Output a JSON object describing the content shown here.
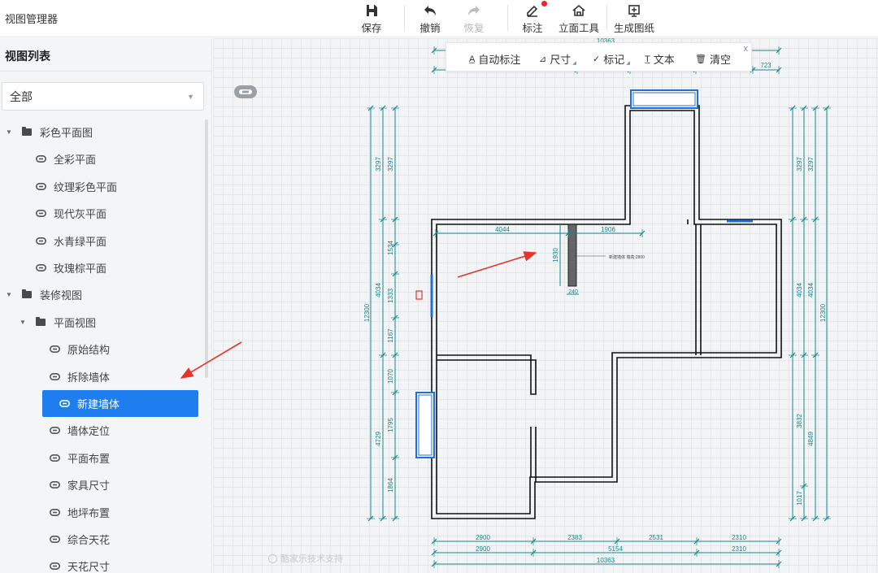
{
  "app": {
    "title": "视图管理器"
  },
  "toolbar": {
    "save": "保存",
    "undo": "撤销",
    "redo": "恢复",
    "annotate": "标注",
    "elevation": "立面工具",
    "generate": "生成图纸"
  },
  "sidebar": {
    "title": "视图列表",
    "select_value": "全部",
    "tree": [
      {
        "label": "彩色平面图",
        "type": "folder",
        "level": 0,
        "expanded": true
      },
      {
        "label": "全彩平面",
        "type": "view",
        "level": 1
      },
      {
        "label": "纹理彩色平面",
        "type": "view",
        "level": 1
      },
      {
        "label": "现代灰平面",
        "type": "view",
        "level": 1
      },
      {
        "label": "水青绿平面",
        "type": "view",
        "level": 1
      },
      {
        "label": "玫瑰棕平面",
        "type": "view",
        "level": 1
      },
      {
        "label": "装修视图",
        "type": "folder",
        "level": 0,
        "expanded": true
      },
      {
        "label": "平面视图",
        "type": "folder",
        "level": 1,
        "expanded": true
      },
      {
        "label": "原始结构",
        "type": "view",
        "level": 2
      },
      {
        "label": "拆除墙体",
        "type": "view",
        "level": 2
      },
      {
        "label": "新建墙体",
        "type": "view",
        "level": 2,
        "selected": true
      },
      {
        "label": "墙体定位",
        "type": "view",
        "level": 2
      },
      {
        "label": "平面布置",
        "type": "view",
        "level": 2
      },
      {
        "label": "家具尺寸",
        "type": "view",
        "level": 2
      },
      {
        "label": "地坪布置",
        "type": "view",
        "level": 2
      },
      {
        "label": "综合天花",
        "type": "view",
        "level": 2
      },
      {
        "label": "天花尺寸",
        "type": "view",
        "level": 2
      }
    ]
  },
  "annotation_bar": {
    "auto": "自动标注",
    "dimension": "尺寸",
    "mark": "标记",
    "text": "文本",
    "clear": "清空",
    "close": "x"
  },
  "plan": {
    "top_dim": "10363",
    "top_right_dim": "723",
    "left_outer": "12300",
    "left_mid": [
      "3297",
      "4034",
      "4729"
    ],
    "left_inner": [
      "3297",
      "1534",
      "1333",
      "1167",
      "1070",
      "1795",
      "1864"
    ],
    "right_outer": "12300",
    "right_mid": [
      "3297",
      "4034",
      "4849"
    ],
    "right_inner": [
      "3297",
      "4034",
      "3832",
      "1017"
    ],
    "bottom_row1": [
      "2900",
      "2383",
      "2531",
      "2310"
    ],
    "bottom_row2": [
      "2900",
      "5154",
      "2310"
    ],
    "bottom_total": "10363",
    "wall_dim_h1": "4044",
    "wall_dim_h2": "1906",
    "wall_dim_v": "1930",
    "wall_thickness": "240",
    "wall_note": "新建墙体 墙高:2800"
  },
  "watermark": "酷家乐技术支持",
  "colors": {
    "accent": "#1e7ef0",
    "dimension": "#14888a",
    "window": "#1f6fd6",
    "arrow": "#e5342c",
    "badge": "#9aa0a6"
  }
}
